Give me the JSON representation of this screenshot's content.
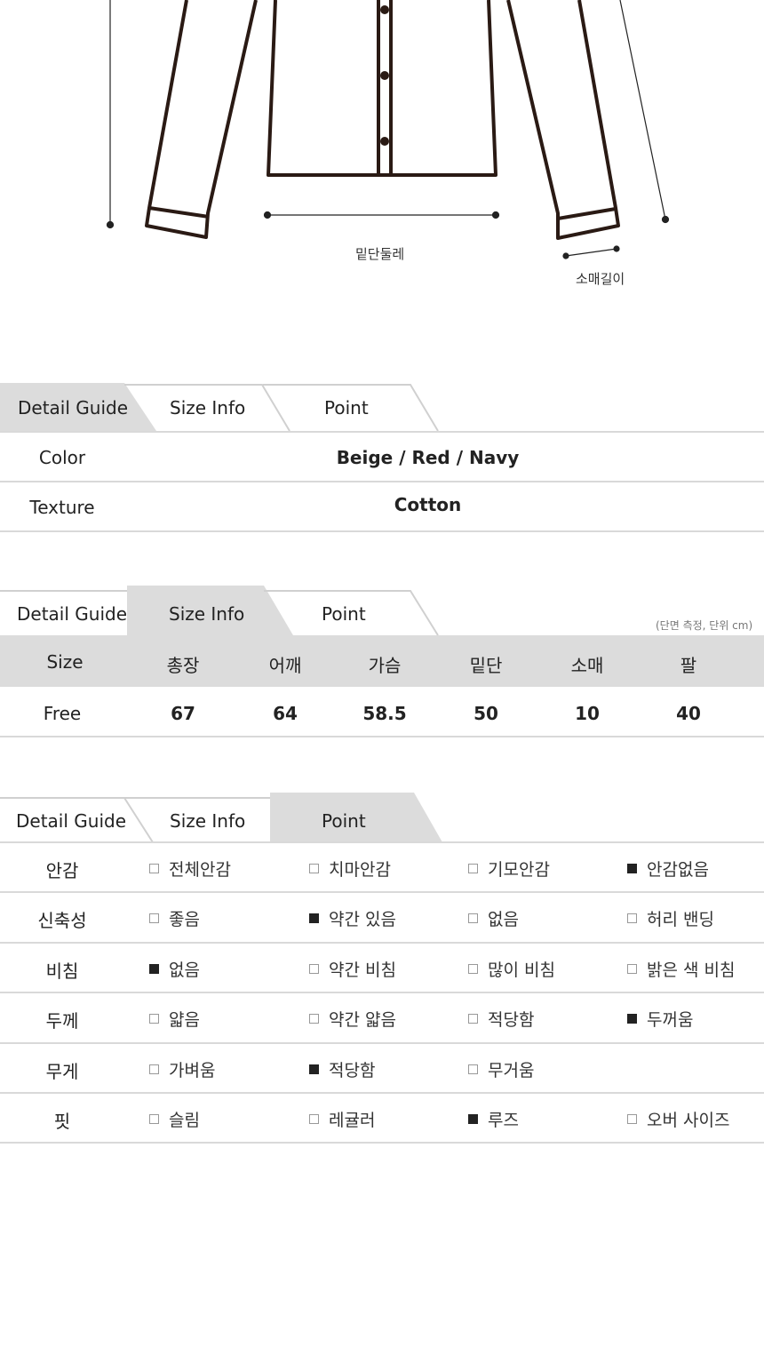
{
  "diagram": {
    "hem_label": "밑단둘레",
    "sleeve_label": "소매길이"
  },
  "tabs": {
    "detail_guide": "Detail Guide",
    "size_info": "Size Info",
    "point": "Point"
  },
  "detail": {
    "rows": [
      {
        "label": "Color",
        "value": "Beige / Red / Navy"
      },
      {
        "label": "Texture",
        "value": "Cotton"
      }
    ]
  },
  "size": {
    "note": "(단면 측정, 단위 cm)",
    "headers": [
      "Size",
      "총장",
      "어깨",
      "가슴",
      "밑단",
      "소매",
      "팔"
    ],
    "values": [
      "Free",
      "67",
      "64",
      "58.5",
      "50",
      "10",
      "40"
    ]
  },
  "point": {
    "rows": [
      {
        "label": "안감",
        "options": [
          {
            "text": "전체안감",
            "checked": false
          },
          {
            "text": "치마안감",
            "checked": false
          },
          {
            "text": "기모안감",
            "checked": false
          },
          {
            "text": "안감없음",
            "checked": true
          }
        ]
      },
      {
        "label": "신축성",
        "options": [
          {
            "text": "좋음",
            "checked": false
          },
          {
            "text": "약간 있음",
            "checked": true
          },
          {
            "text": "없음",
            "checked": false
          },
          {
            "text": "허리 밴딩",
            "checked": false
          }
        ]
      },
      {
        "label": "비침",
        "options": [
          {
            "text": "없음",
            "checked": true
          },
          {
            "text": "약간 비침",
            "checked": false
          },
          {
            "text": "많이 비침",
            "checked": false
          },
          {
            "text": "밝은 색 비침",
            "checked": false
          }
        ]
      },
      {
        "label": "두께",
        "options": [
          {
            "text": "얇음",
            "checked": false
          },
          {
            "text": "약간 얇음",
            "checked": false
          },
          {
            "text": "적당함",
            "checked": false
          },
          {
            "text": "두꺼움",
            "checked": true
          }
        ]
      },
      {
        "label": "무게",
        "options": [
          {
            "text": "가벼움",
            "checked": false
          },
          {
            "text": "적당함",
            "checked": true
          },
          {
            "text": "무거움",
            "checked": false
          }
        ]
      },
      {
        "label": "핏",
        "options": [
          {
            "text": "슬림",
            "checked": false
          },
          {
            "text": "레귤러",
            "checked": false
          },
          {
            "text": "루즈",
            "checked": true
          },
          {
            "text": "오버 사이즈",
            "checked": false
          }
        ]
      }
    ]
  }
}
